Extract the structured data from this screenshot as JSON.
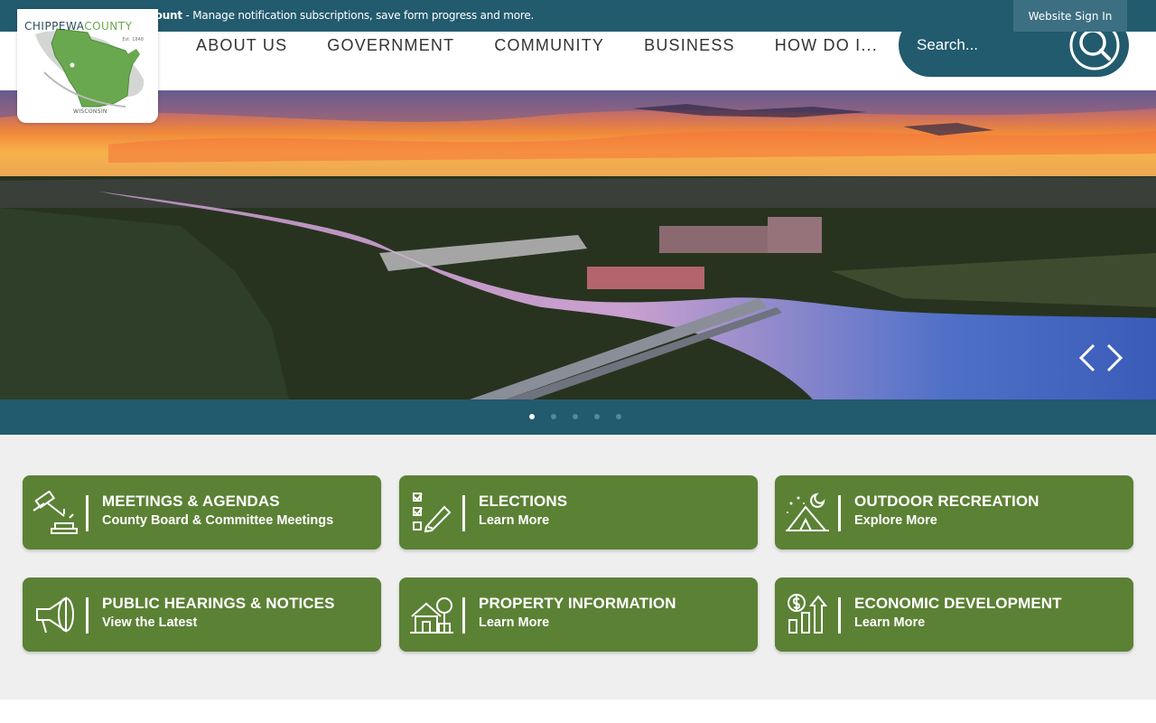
{
  "topbar": {
    "account_link": "Create a Website Account",
    "account_text": " - Manage notification subscriptions, save form progress and more.",
    "signin_label": "Website Sign In"
  },
  "logo": {
    "title_part1": "CHIPPEWA",
    "title_part2": "COUNTY",
    "est": "Est. 1848",
    "state": "WISCONSIN"
  },
  "nav": {
    "items": [
      "ABOUT US",
      "GOVERNMENT",
      "COMMUNITY",
      "BUSINESS",
      "HOW DO I..."
    ]
  },
  "search": {
    "placeholder": "Search..."
  },
  "carousel": {
    "slide_count": 5,
    "active_index": 0
  },
  "tiles": [
    {
      "title": "MEETINGS & AGENDAS",
      "subtitle": "County Board & Committee Meetings",
      "icon": "gavel-icon"
    },
    {
      "title": "ELECTIONS",
      "subtitle": "Learn More",
      "icon": "ballot-checklist-icon"
    },
    {
      "title": "OUTDOOR RECREATION",
      "subtitle": "Explore More",
      "icon": "tent-icon"
    },
    {
      "title": "PUBLIC HEARINGS & NOTICES",
      "subtitle": "View the Latest",
      "icon": "megaphone-icon"
    },
    {
      "title": "PROPERTY INFORMATION",
      "subtitle": "Learn More",
      "icon": "house-icon"
    },
    {
      "title": "ECONOMIC DEVELOPMENT",
      "subtitle": "Learn More",
      "icon": "growth-chart-icon"
    }
  ],
  "colors": {
    "brand_teal": "#225a6e",
    "tile_green": "#5b8135",
    "background_gray": "#efefef"
  }
}
